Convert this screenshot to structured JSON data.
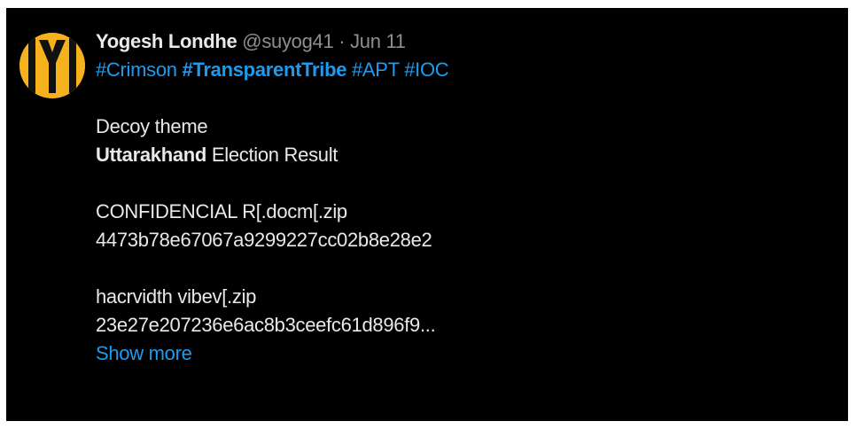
{
  "author": {
    "name": "Yogesh Londhe",
    "handle": "@suyog41",
    "separator": "·",
    "date": "Jun 11"
  },
  "hashtags": [
    {
      "text": "#Crimson",
      "bold": false
    },
    {
      "text": "#TransparentTribe",
      "bold": true
    },
    {
      "text": "#APT",
      "bold": false
    },
    {
      "text": "#IOC",
      "bold": false
    }
  ],
  "body": {
    "decoy_label": "Decoy theme",
    "decoy_title_bold": "Uttarakhand",
    "decoy_title_rest": " Election Result",
    "file1_name": "CONFIDENCIAL R[.docm[.zip",
    "file1_hash": "4473b78e67067a9299227cc02b8e28e2",
    "file2_name": "hacrvidth vibev[.zip",
    "file2_hash": "23e27e207236e6ac8b3ceefc61d896f9..."
  },
  "show_more_label": "Show more",
  "colors": {
    "background": "#000000",
    "text": "#e7e9ea",
    "muted": "#8b8f94",
    "link": "#1d9bf0",
    "avatar": "#f5b21c"
  }
}
